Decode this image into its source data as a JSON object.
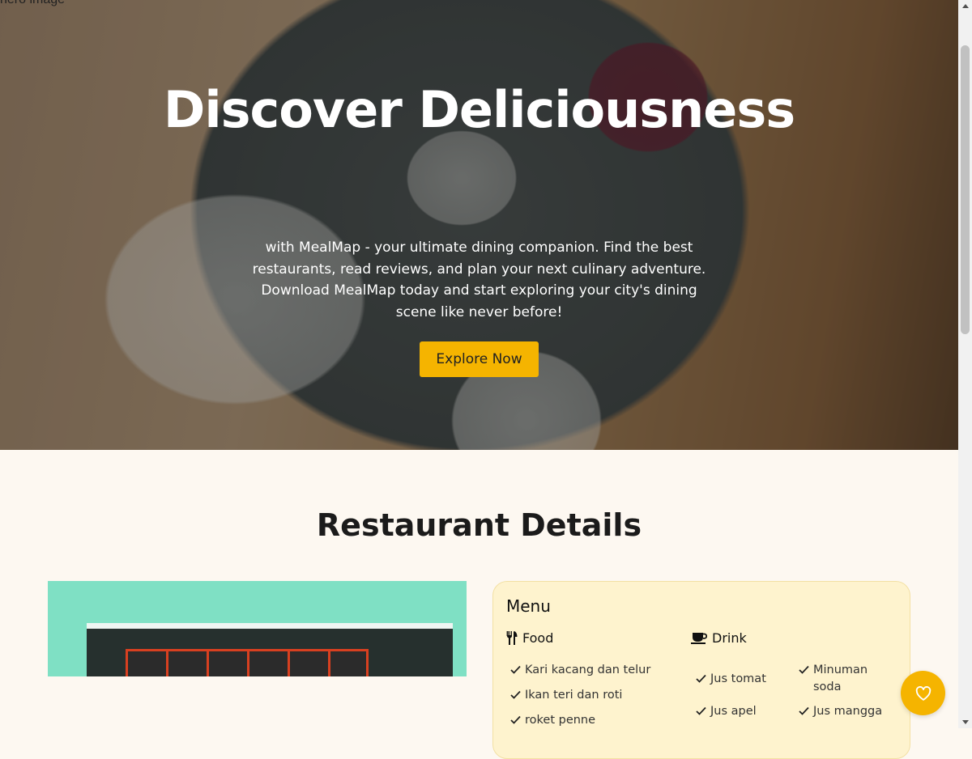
{
  "hero": {
    "image_alt": "hero image",
    "title": "Discover Deliciousness",
    "description": "with MealMap - your ultimate dining companion. Find the best restaurants, read reviews, and plan your next culinary adventure. Download MealMap today and start exploring your city's dining scene like never before!",
    "cta_label": "Explore Now"
  },
  "details": {
    "title": "Restaurant Details",
    "menu": {
      "title": "Menu",
      "food": {
        "label": "Food",
        "icon": "utensils-icon",
        "items": [
          "Kari kacang dan telur",
          "Ikan teri dan roti",
          "roket penne"
        ]
      },
      "drink": {
        "label": "Drink",
        "icon": "coffee-cup-icon",
        "items": [
          "Jus tomat",
          "Minuman soda",
          "Jus apel",
          "Jus mangga"
        ]
      }
    }
  },
  "colors": {
    "accent": "#f5b400",
    "menu_card_bg": "#fef3ce",
    "page_bg": "#fdf8f1"
  },
  "fab": {
    "icon": "heart-icon"
  }
}
